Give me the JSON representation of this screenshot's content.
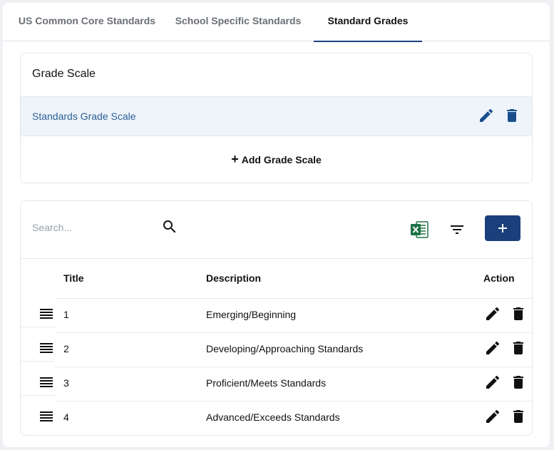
{
  "tabs": [
    {
      "label": "US Common Core Standards",
      "active": false
    },
    {
      "label": "School Specific Standards",
      "active": false
    },
    {
      "label": "Standard Grades",
      "active": true
    }
  ],
  "grade_scale": {
    "title": "Grade Scale",
    "items": [
      {
        "label": "Standards Grade Scale"
      }
    ],
    "add_label": "Add Grade Scale"
  },
  "table": {
    "search": {
      "placeholder": "Search...",
      "value": ""
    },
    "columns": {
      "title": "Title",
      "description": "Description",
      "action": "Action"
    },
    "rows": [
      {
        "title": "1",
        "description": "Emerging/Beginning"
      },
      {
        "title": "2",
        "description": "Developing/Approaching Standards"
      },
      {
        "title": "3",
        "description": "Proficient/Meets Standards"
      },
      {
        "title": "4",
        "description": "Advanced/Exceeds Standards"
      }
    ]
  },
  "icons": {
    "search": "search-icon",
    "excel": "excel-icon",
    "filter": "filter-icon",
    "add": "plus-icon",
    "edit": "pencil-icon",
    "delete": "trash-icon",
    "drag": "drag-handle-icon"
  },
  "colors": {
    "accent": "#1a3f7a",
    "link": "#2b5f96",
    "selected_row_bg": "#eef4fa",
    "excel_green": "#1e7145"
  }
}
